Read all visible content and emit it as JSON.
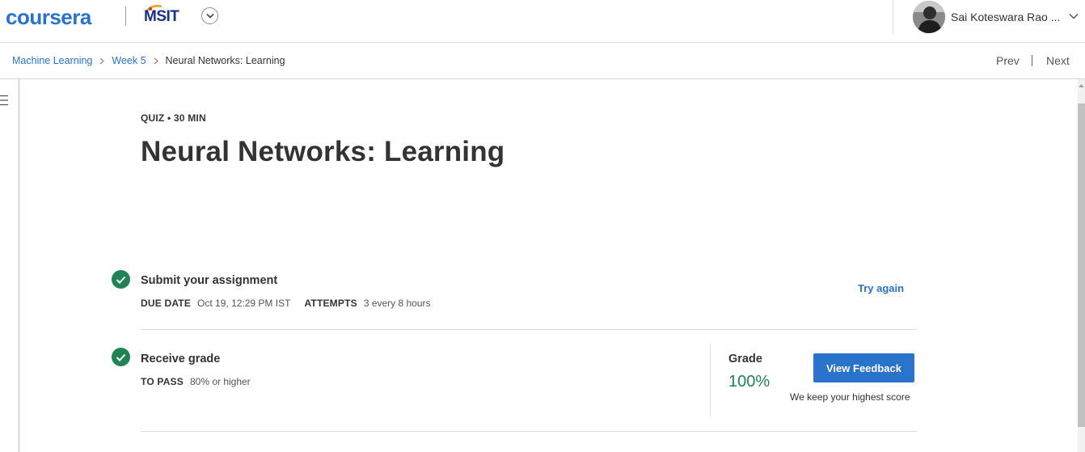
{
  "header": {
    "brand": "coursera",
    "partner_logo_text": "MSIT",
    "user_name": "Sai Koteswara Rao ..."
  },
  "breadcrumb": {
    "items": [
      "Machine Learning",
      "Week 5"
    ],
    "current": "Neural Networks: Learning"
  },
  "nav": {
    "prev": "Prev",
    "next": "Next"
  },
  "quiz": {
    "overline": "QUIZ • 30 MIN",
    "title": "Neural Networks: Learning"
  },
  "submit_step": {
    "title": "Submit your assignment",
    "due_label": "DUE DATE",
    "due_value": "Oct 19, 12:29 PM IST",
    "attempts_label": "ATTEMPTS",
    "attempts_value": "3 every 8 hours",
    "action": "Try again"
  },
  "grade_step": {
    "title": "Receive grade",
    "pass_label": "TO PASS",
    "pass_value": "80% or higher",
    "grade_label": "Grade",
    "grade_value": "100%",
    "button": "View Feedback",
    "note": "We keep your highest score"
  },
  "colors": {
    "accent": "#2a73cc",
    "success": "#1f8354",
    "partner": "#1b2f8a"
  }
}
